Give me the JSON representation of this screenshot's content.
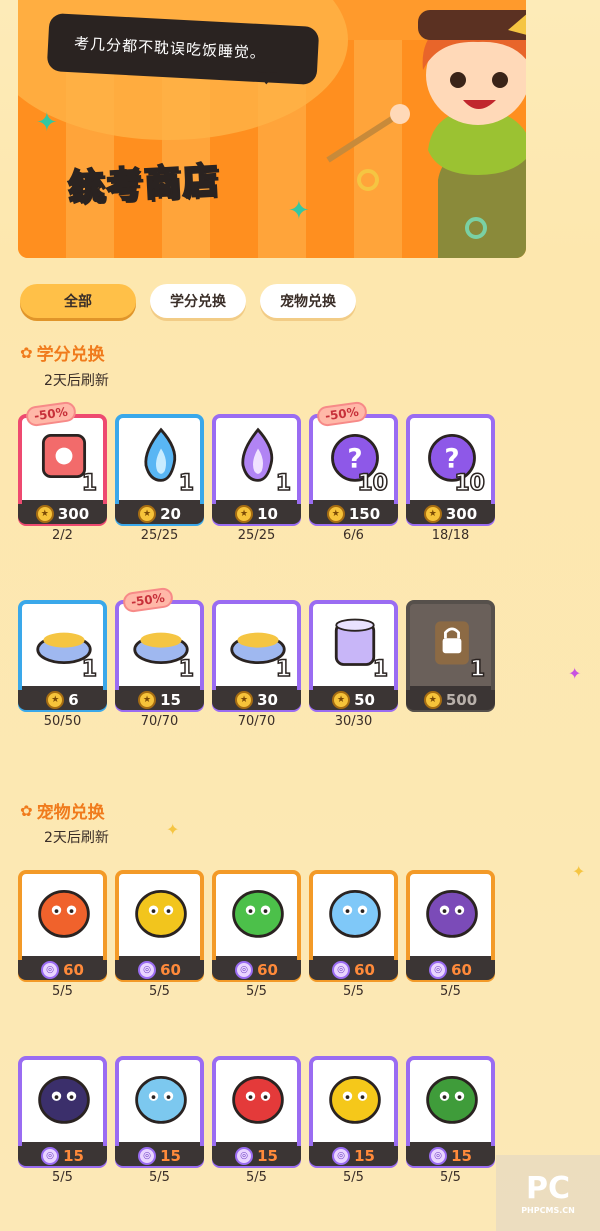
{
  "banner": {
    "speech": "考几分都不耽误吃饭睡觉。",
    "title": "统考商店"
  },
  "tabs": [
    {
      "label": "全部",
      "active": true
    },
    {
      "label": "学分兑换",
      "active": false
    },
    {
      "label": "宠物兑换",
      "active": false
    }
  ],
  "credit_section": {
    "title": "学分兑换",
    "refresh": "2天后刷新"
  },
  "pet_section": {
    "title": "宠物兑换",
    "refresh": "2天后刷新"
  },
  "credit_items": [
    {
      "name": "red-dice",
      "discount": "-50%",
      "qty": "1",
      "price": "300",
      "stock": "2/2",
      "frame": "red",
      "icon": "dice-icon"
    },
    {
      "name": "blue-flame",
      "discount": "",
      "qty": "1",
      "price": "20",
      "stock": "25/25",
      "frame": "blue",
      "icon": "blue-flame-icon"
    },
    {
      "name": "purple-flame",
      "discount": "",
      "qty": "1",
      "price": "10",
      "stock": "25/25",
      "frame": "purple",
      "icon": "purple-flame-icon"
    },
    {
      "name": "mystery-egg-10",
      "discount": "-50%",
      "qty": "10",
      "price": "150",
      "stock": "6/6",
      "frame": "purple",
      "icon": "mystery-egg-icon"
    },
    {
      "name": "mystery-egg-10b",
      "discount": "",
      "qty": "10",
      "price": "300",
      "stock": "18/18",
      "frame": "purple",
      "icon": "mystery-egg-icon"
    },
    {
      "name": "food-bowl-blue",
      "discount": "",
      "qty": "1",
      "price": "6",
      "stock": "50/50",
      "frame": "blue",
      "icon": "food-bowl-icon"
    },
    {
      "name": "food-bowl-purple",
      "discount": "-50%",
      "qty": "1",
      "price": "15",
      "stock": "70/70",
      "frame": "purple",
      "icon": "food-bowl-icon"
    },
    {
      "name": "food-bowl-purple2",
      "discount": "",
      "qty": "1",
      "price": "30",
      "stock": "70/70",
      "frame": "purple",
      "icon": "food-bowl-icon"
    },
    {
      "name": "food-can",
      "discount": "",
      "qty": "1",
      "price": "50",
      "stock": "30/30",
      "frame": "purple",
      "icon": "food-can-icon"
    },
    {
      "name": "locked-can",
      "discount": "",
      "qty": "1",
      "price": "500",
      "stock": "",
      "frame": "locked",
      "icon": "lock-icon"
    }
  ],
  "pet_items": [
    {
      "name": "octopus-pet",
      "price": "60",
      "stock": "5/5",
      "icon": "octopus-icon",
      "color": "#f0622c"
    },
    {
      "name": "pufferfish-pet",
      "price": "60",
      "stock": "5/5",
      "icon": "pufferfish-icon",
      "color": "#f2c51d"
    },
    {
      "name": "pepper-pet",
      "price": "60",
      "stock": "5/5",
      "icon": "pepper-icon",
      "color": "#4cc04a"
    },
    {
      "name": "rabbit-pet",
      "price": "60",
      "stock": "5/5",
      "icon": "rabbit-icon",
      "color": "#7fc8f8"
    },
    {
      "name": "grape-pet",
      "price": "60",
      "stock": "5/5",
      "icon": "grape-icon",
      "color": "#7b4bb8"
    },
    {
      "name": "cat-pet",
      "price": "15",
      "stock": "5/5",
      "icon": "cat-icon",
      "color": "#3b2f6b"
    },
    {
      "name": "fish-pet",
      "price": "15",
      "stock": "5/5",
      "icon": "fish-icon",
      "color": "#7cc8ef"
    },
    {
      "name": "shark-pet",
      "price": "15",
      "stock": "5/5",
      "icon": "shark-icon",
      "color": "#e43a3a"
    },
    {
      "name": "bulb-pet",
      "price": "15",
      "stock": "5/5",
      "icon": "bulb-icon",
      "color": "#f5c81a"
    },
    {
      "name": "sprout-pet",
      "price": "15",
      "stock": "5/5",
      "icon": "sprout-icon",
      "color": "#3f9c3a"
    }
  ],
  "watermark": {
    "big": "PC",
    "small": "PHPCMS.CN"
  }
}
